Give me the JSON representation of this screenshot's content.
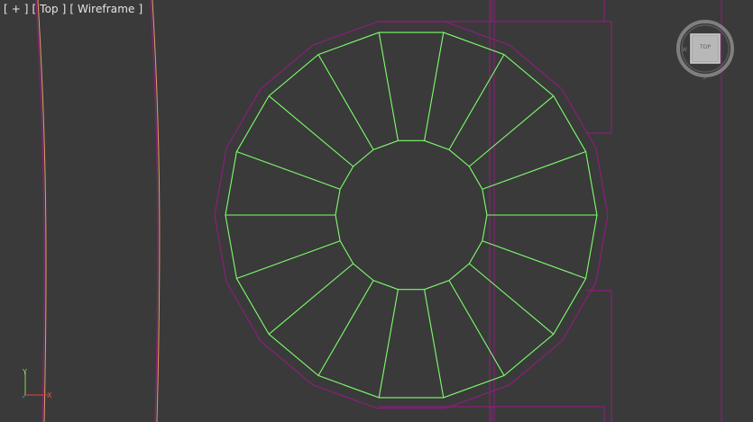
{
  "viewport": {
    "label_prefix": "[ + ] [ ",
    "view_name": "Top",
    "label_mid": " ] [ ",
    "shading_mode": "Wireframe",
    "label_suffix": " ]"
  },
  "viewcube": {
    "face_label": "TOP"
  },
  "axis_tripod": {
    "y_label": "Y",
    "x_label": "X"
  },
  "colors": {
    "background": "#3a3a3a",
    "selected_wire": "#7cff6b",
    "outline_purple": "#8a1f7a",
    "outline_orange": "#e0a060",
    "label_text": "#e6e6e6"
  },
  "mesh": {
    "segments": 18
  }
}
